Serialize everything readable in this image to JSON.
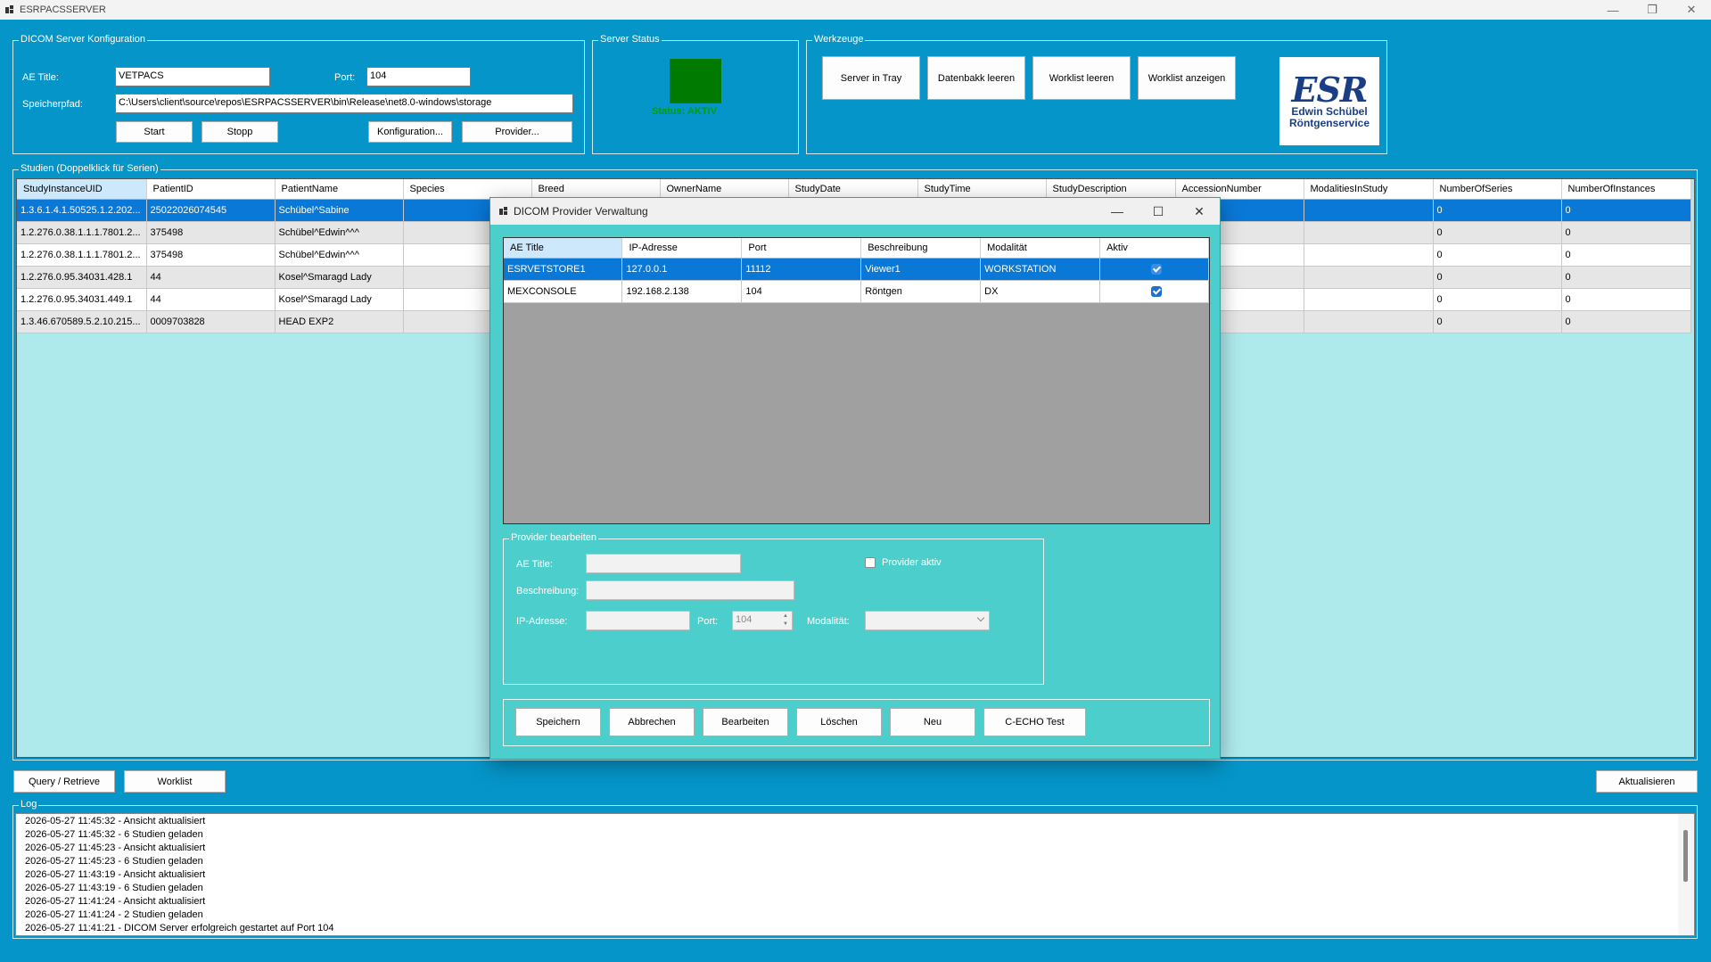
{
  "window": {
    "title": "ESRPACSSERVER",
    "controls": [
      "—",
      "❐",
      "✕"
    ]
  },
  "config": {
    "legend": "DICOM Server Konfiguration",
    "ae_label": "AE Title:",
    "ae_value": "VETPACS",
    "port_label": "Port:",
    "port_value": "104",
    "path_label": "Speicherpfad:",
    "path_value": "C:\\Users\\client\\source\\repos\\ESRPACSSERVER\\bin\\Release\\net8.0-windows\\storage",
    "start": "Start",
    "stop": "Stopp",
    "konfig": "Konfiguration...",
    "provider": "Provider..."
  },
  "status": {
    "legend": "Server Status",
    "text": "Status: AKTIV",
    "color": "#007a00"
  },
  "tools": {
    "legend": "Werkzeuge",
    "tray": "Server in Tray",
    "clear_db": "Datenbakk leeren",
    "clear_wl": "Worklist leeren",
    "show_wl": "Worklist anzeigen"
  },
  "logo": {
    "mark": "ESR",
    "line1": "Edwin Schübel",
    "line2": "Röntgenservice"
  },
  "studies": {
    "legend": "Studien (Doppelklick für Serien)",
    "columns": [
      "StudyInstanceUID",
      "PatientID",
      "PatientName",
      "Species",
      "Breed",
      "OwnerName",
      "StudyDate",
      "StudyTime",
      "StudyDescription",
      "AccessionNumber",
      "ModalitiesInStudy",
      "NumberOfSeries",
      "NumberOfInstances"
    ],
    "rows": [
      [
        "1.3.6.1.4.1.50525.1.2.202...",
        "25022026074545",
        "Schübel^Sabine",
        "",
        "",
        "",
        "",
        "",
        "",
        "",
        "",
        "0",
        "0"
      ],
      [
        "1.2.276.0.38.1.1.1.7801.2...",
        "375498",
        "Schübel^Edwin^^^",
        "",
        "",
        "",
        "",
        "",
        "",
        "",
        "",
        "0",
        "0"
      ],
      [
        "1.2.276.0.38.1.1.1.7801.2...",
        "375498",
        "Schübel^Edwin^^^",
        "",
        "",
        "",
        "",
        "",
        "",
        "",
        "",
        "0",
        "0"
      ],
      [
        "1.2.276.0.95.34031.428.1",
        "44",
        "Kosel^Smaragd Lady",
        "",
        "",
        "",
        "",
        "",
        "",
        "",
        "",
        "0",
        "0"
      ],
      [
        "1.2.276.0.95.34031.449.1",
        "44",
        "Kosel^Smaragd Lady",
        "",
        "",
        "",
        "",
        "",
        "",
        "",
        "",
        "0",
        "0"
      ],
      [
        "1.3.46.670589.5.2.10.215...",
        "0009703828",
        "HEAD EXP2",
        "",
        "",
        "",
        "",
        "",
        "",
        "",
        "",
        "0",
        "0"
      ]
    ]
  },
  "bottom": {
    "query": "Query / Retrieve",
    "worklist": "Worklist",
    "refresh": "Aktualisieren"
  },
  "log": {
    "legend": "Log",
    "lines": [
      "2026-05-27 11:45:32 - Ansicht aktualisiert",
      "2026-05-27 11:45:32 - 6 Studien geladen",
      "2026-05-27 11:45:23 - Ansicht aktualisiert",
      "2026-05-27 11:45:23 - 6 Studien geladen",
      "2026-05-27 11:43:19 - Ansicht aktualisiert",
      "2026-05-27 11:43:19 - 6 Studien geladen",
      "2026-05-27 11:41:24 - Ansicht aktualisiert",
      "2026-05-27 11:41:24 - 2 Studien geladen",
      "2026-05-27 11:41:21 - DICOM Server erfolgreich gestartet auf Port 104"
    ]
  },
  "dialog": {
    "title": "DICOM Provider Verwaltung",
    "controls": [
      "—",
      "☐",
      "✕"
    ],
    "columns": [
      "AE Title",
      "IP-Adresse",
      "Port",
      "Beschreibung",
      "Modalität",
      "Aktiv"
    ],
    "rows": [
      {
        "ae": "ESRVETSTORE1",
        "ip": "127.0.0.1",
        "port": "11112",
        "desc": "Viewer1",
        "mod": "WORKSTATION",
        "active": true
      },
      {
        "ae": "MEXCONSOLE",
        "ip": "192.168.2.138",
        "port": "104",
        "desc": "Röntgen",
        "mod": "DX",
        "active": true
      }
    ],
    "edit": {
      "legend": "Provider bearbeiten",
      "ae_label": "AE Title:",
      "desc_label": "Beschreibung:",
      "ip_label": "IP-Adresse:",
      "port_label": "Port:",
      "port_value": "104",
      "mod_label": "Modalität:",
      "active_label": "Provider aktiv"
    },
    "buttons": {
      "save": "Speichern",
      "cancel": "Abbrechen",
      "edit": "Bearbeiten",
      "delete": "Löschen",
      "new": "Neu",
      "echo": "C-ECHO Test"
    }
  }
}
